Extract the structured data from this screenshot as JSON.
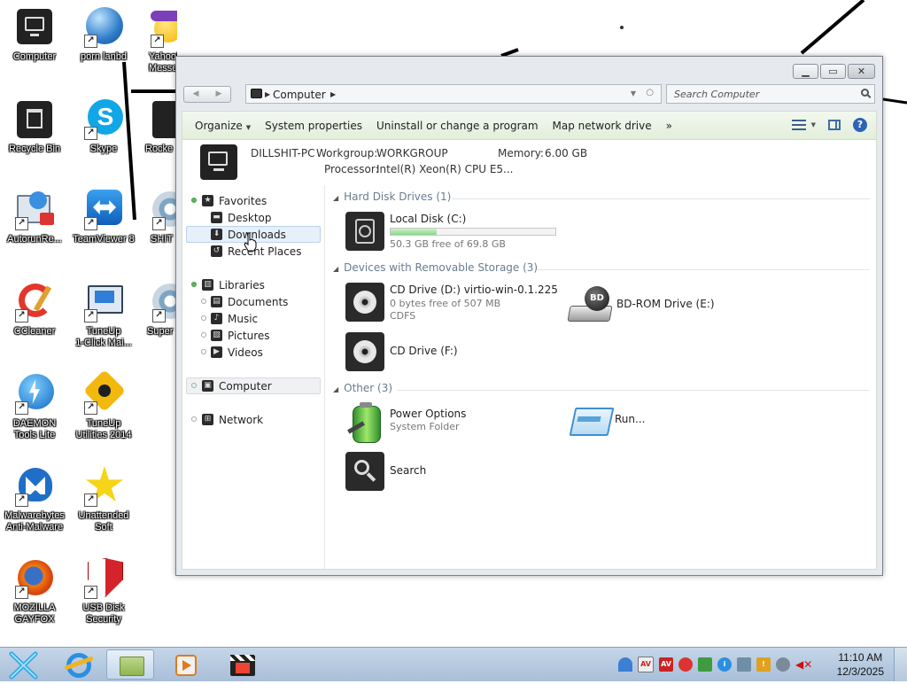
{
  "desktop": {
    "icons": [
      {
        "label": "Computer"
      },
      {
        "label": "porn lanbd"
      },
      {
        "label": "Yahoo! Messe"
      },
      {
        "label": "Recycle Bin"
      },
      {
        "label": "Skype"
      },
      {
        "label": "Rocke"
      },
      {
        "label": "AutorunRe..."
      },
      {
        "label": "TeamViewer 8"
      },
      {
        "label": "SHIT"
      },
      {
        "label": "CCleaner"
      },
      {
        "label": "TuneUp\n1-Click Mai..."
      },
      {
        "label": "Super"
      },
      {
        "label": "DAEMON\nTools Lite"
      },
      {
        "label": "TuneUp\nUtilities 2014"
      },
      {
        "label": "Malwarebytes\nAnti-Malware"
      },
      {
        "label": "Unattended\nSoft"
      },
      {
        "label": "MOZILLA\nGAYFOX"
      },
      {
        "label": "USB Disk\nSecurity"
      }
    ]
  },
  "window": {
    "address": {
      "crumb": "Computer"
    },
    "search": {
      "placeholder": "Search Computer"
    },
    "caption": {
      "minimize": "▁",
      "maximize": "▭",
      "close": "✕"
    },
    "toolbar": {
      "organize": "Organize",
      "system_properties": "System properties",
      "uninstall": "Uninstall or change a program",
      "map_drive": "Map network drive",
      "more": "»"
    },
    "details": {
      "pc_name": "DILLSHIT-PC",
      "workgroup_label": "Workgroup:",
      "workgroup": "WORKGROUP",
      "memory_label": "Memory:",
      "memory": "6.00 GB",
      "processor_label": "Processor:",
      "processor": "Intel(R) Xeon(R) CPU E5..."
    },
    "nav": {
      "favorites": "Favorites",
      "desktop": "Desktop",
      "downloads": "Downloads",
      "recent": "Recent Places",
      "libraries": "Libraries",
      "documents": "Documents",
      "music": "Music",
      "pictures": "Pictures",
      "videos": "Videos",
      "computer": "Computer",
      "network": "Network"
    },
    "groups": {
      "hdd": "Hard Disk Drives (1)",
      "removable": "Devices with Removable Storage (3)",
      "other": "Other (3)"
    },
    "items": {
      "local_disk": {
        "name": "Local Disk (C:)",
        "free": "50.3 GB free of 69.8 GB",
        "used_fraction": 0.28
      },
      "cd_d": {
        "name": "CD Drive (D:) virtio-win-0.1.225",
        "free": "0 bytes free of 507 MB",
        "fs": "CDFS"
      },
      "bd_e": {
        "name": "BD-ROM Drive (E:)",
        "badge": "BD"
      },
      "cd_f": {
        "name": "CD Drive (F:)"
      },
      "power": {
        "name": "Power Options",
        "sub": "System Folder"
      },
      "run": {
        "name": "Run..."
      },
      "search": {
        "name": "Search"
      }
    }
  },
  "taskbar": {
    "clock_time": "11:10 AM",
    "clock_date": "12/3/2025",
    "tray": [
      "AV",
      "AV",
      "!",
      "i"
    ]
  },
  "colors": {
    "accent": "#2c63b8",
    "disk_fill": "#86d983",
    "taskbar": "#b5c9de"
  }
}
